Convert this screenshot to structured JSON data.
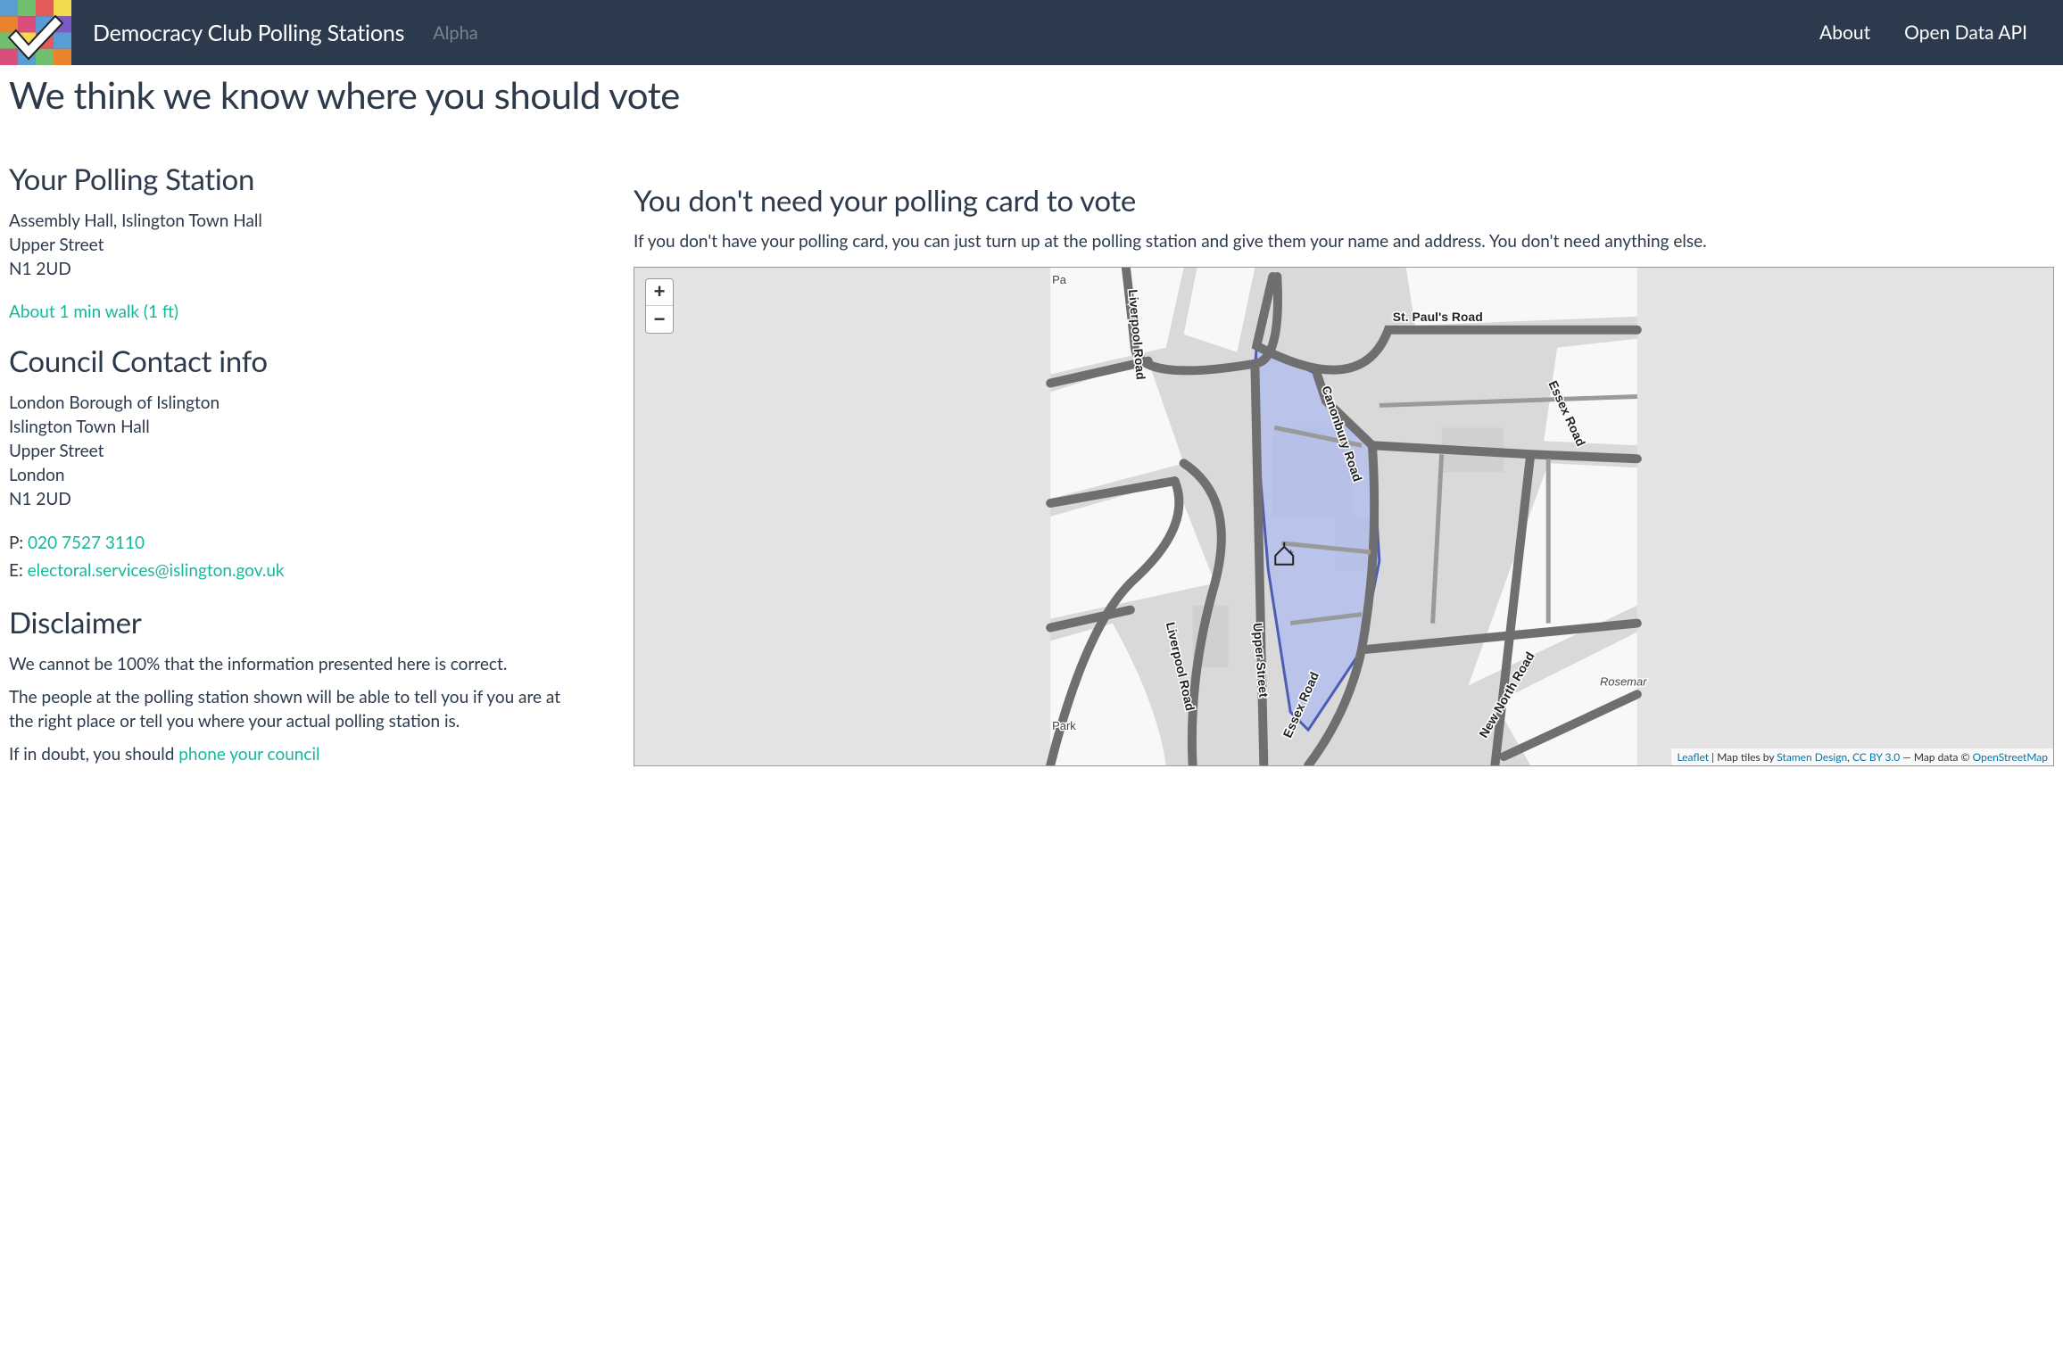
{
  "nav": {
    "brand": "Democracy Club Polling Stations",
    "alpha": "Alpha",
    "links": {
      "about": "About",
      "api": "Open Data API"
    }
  },
  "page_title": "We think we know where you should vote",
  "polling": {
    "heading": "Your Polling Station",
    "address_line1": "Assembly Hall, Islington Town Hall",
    "address_line2": "Upper Street",
    "address_line3": "N1 2UD",
    "walk_link": "About 1 min walk (1 ft)"
  },
  "council": {
    "heading": "Council Contact info",
    "line1": "London Borough of Islington",
    "line2": "Islington Town Hall",
    "line3": "Upper Street",
    "line4": "London",
    "line5": "N1 2UD",
    "phone_label": "P: ",
    "phone": "020 7527 3110",
    "email_label": "E: ",
    "email": "electoral.services@islington.gov.uk"
  },
  "disclaimer": {
    "heading": "Disclaimer",
    "p1": "We cannot be 100% that the information presented here is correct.",
    "p2": "The people at the polling station shown will be able to tell you if you are at the right place or tell you where your actual polling station is.",
    "p3_prefix": "If in doubt, you should ",
    "p3_link": "phone your council"
  },
  "right": {
    "heading": "You don't need your polling card to vote",
    "text": "If you don't have your polling card, you can just turn up at the polling station and give them your name and address. You don't need anything else."
  },
  "map": {
    "zoom_in": "+",
    "zoom_out": "−",
    "roads": {
      "liverpool": "Liverpool Road",
      "stpauls": "St. Paul's Road",
      "canonbury": "Canonbury Road",
      "essex_nw": "Essex Road",
      "essex_s": "Essex Road",
      "upper": "Upper Street",
      "liverpool_s": "Liverpool Road",
      "newnorth": "New North Road",
      "rosemar": "Rosemar",
      "park": "Park",
      "pa": "Pa"
    },
    "attribution": {
      "leaflet": "Leaflet",
      "sep1": " | Map tiles by ",
      "stamen": "Stamen Design",
      "sep2": ", ",
      "cc": "CC BY 3.0",
      "sep3": " — Map data © ",
      "osm": "OpenStreetMap"
    }
  }
}
